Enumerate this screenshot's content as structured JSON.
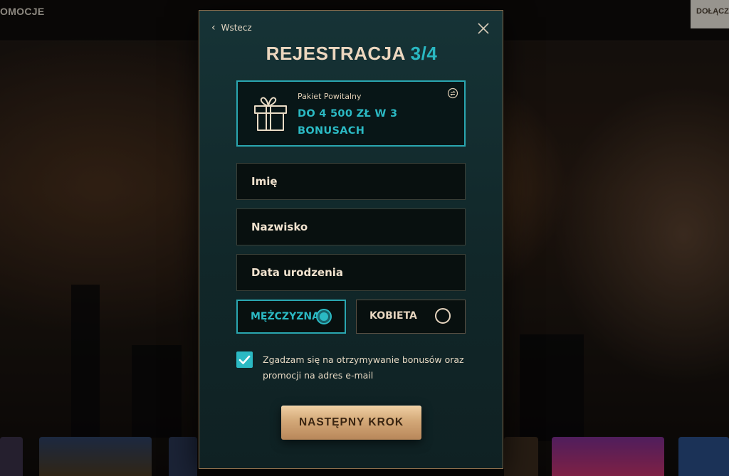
{
  "background": {
    "nav_link": "OMOCJE",
    "join_button": "DOŁĄCZ"
  },
  "modal": {
    "back_label": "Wstecz",
    "title": "REJESTRACJA",
    "step": "3/4",
    "promo": {
      "label": "Pakiet Powitalny",
      "value": "DO 4 500 ZŁ W 3 BONUSACH"
    },
    "fields": {
      "first_name_placeholder": "Imię",
      "last_name_placeholder": "Nazwisko",
      "birthdate_placeholder": "Data urodzenia"
    },
    "gender": {
      "male_label": "MĘŻCZYZNA",
      "female_label": "KOBIETA",
      "selected": "male"
    },
    "consent": {
      "checked": true,
      "text": "Zgadzam się na otrzymywanie bonusów oraz promocji na adres e-mail"
    },
    "next_button": "NASTĘPNY KROK"
  },
  "colors": {
    "accent_teal": "#2bb9c3",
    "gold": "#ecd7bf",
    "button_gold": "#d3a878",
    "modal_bg": "#163336"
  }
}
